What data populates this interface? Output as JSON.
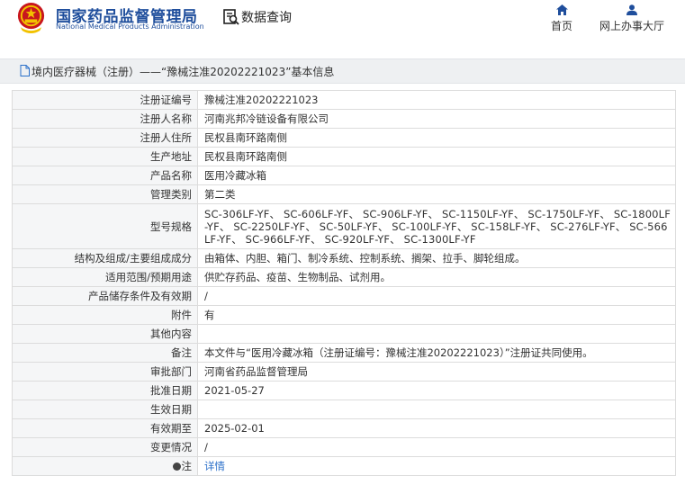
{
  "header": {
    "site_name": "国家药品监督管理局",
    "site_name_en": "National Medical Products Administration",
    "query_label": "数据查询",
    "nav": {
      "home": "首页",
      "online_service": "网上办事大厅"
    },
    "brand_color": "#1f4e9c"
  },
  "breadcrumb": "境内医疗器械（注册）——“豫械注准20202221023”基本信息",
  "fields": [
    {
      "label": "注册证编号",
      "value": "豫械注准20202221023"
    },
    {
      "label": "注册人名称",
      "value": "河南兆邦冷链设备有限公司"
    },
    {
      "label": "注册人住所",
      "value": "民权县南环路南侧"
    },
    {
      "label": "生产地址",
      "value": "民权县南环路南侧"
    },
    {
      "label": "产品名称",
      "value": "医用冷藏冰箱"
    },
    {
      "label": "管理类别",
      "value": "第二类"
    },
    {
      "label": "型号规格",
      "value": "SC-306LF-YF、 SC-606LF-YF、 SC-906LF-YF、 SC-1150LF-YF、 SC-1750LF-YF、 SC-1800LF-YF、 SC-2250LF-YF、 SC-50LF-YF、 SC-100LF-YF、 SC-158LF-YF、 SC-276LF-YF、 SC-566LF-YF、 SC-966LF-YF、 SC-920LF-YF、 SC-1300LF-YF"
    },
    {
      "label": "结构及组成/主要组成成分",
      "value": "由箱体、内胆、箱门、制冷系统、控制系统、搁架、拉手、脚轮组成。"
    },
    {
      "label": "适用范围/预期用途",
      "value": "供贮存药品、疫苗、生物制品、试剂用。"
    },
    {
      "label": "产品储存条件及有效期",
      "value": "/"
    },
    {
      "label": "附件",
      "value": "有"
    },
    {
      "label": "其他内容",
      "value": ""
    },
    {
      "label": "备注",
      "value": "本文件与“医用冷藏冰箱（注册证编号：豫械注准20202221023）”注册证共同使用。"
    },
    {
      "label": "审批部门",
      "value": "河南省药品监督管理局"
    },
    {
      "label": "批准日期",
      "value": "2021-05-27"
    },
    {
      "label": "生效日期",
      "value": ""
    },
    {
      "label": "有效期至",
      "value": "2025-02-01"
    },
    {
      "label": "变更情况",
      "value": "/"
    }
  ],
  "note": {
    "label": "注",
    "link_text": "详情"
  },
  "colors": {
    "link": "#2a6fc9",
    "label_bg": "#f5f6f7",
    "border": "#dcdcdc"
  }
}
